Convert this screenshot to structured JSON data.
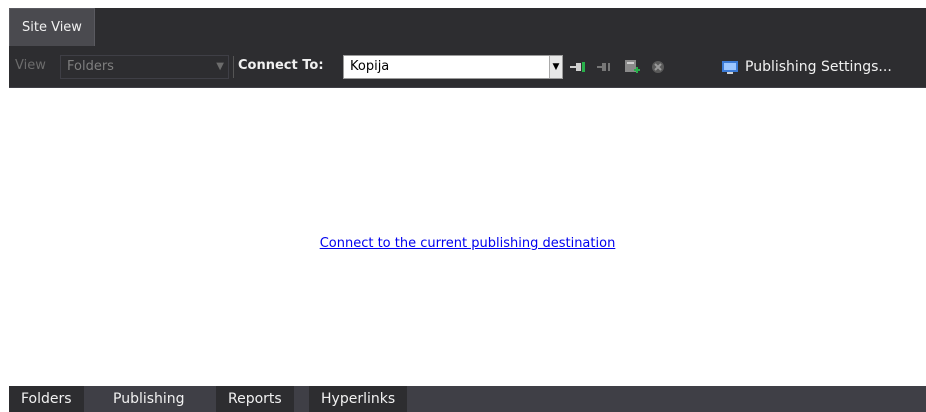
{
  "tab": {
    "label": "Site View"
  },
  "toolbar": {
    "view_label": "View",
    "view_value": "Folders",
    "connect_label": "Connect To:",
    "connect_value": "Kopija",
    "publishing_settings_label": "Publishing Settings..."
  },
  "content": {
    "link_text": "Connect to the current publishing destination"
  },
  "bottom_tabs": [
    "Folders",
    "Publishing",
    "Reports",
    "Hyperlinks"
  ],
  "icons": {
    "view_dropdown": "chevron-down-icon",
    "connect_dropdown": "chevron-down-icon",
    "connect": "connect-plug-icon",
    "disconnect": "disconnect-plug-icon",
    "publish_to_remote": "publish-add-icon",
    "stop": "stop-icon",
    "publishing_settings": "publishing-settings-icon"
  },
  "colors": {
    "chrome_dark": "#2d2d30",
    "tab_bg": "#4a4a4f",
    "link": "#0000ee",
    "accent_green": "#28b04a"
  }
}
